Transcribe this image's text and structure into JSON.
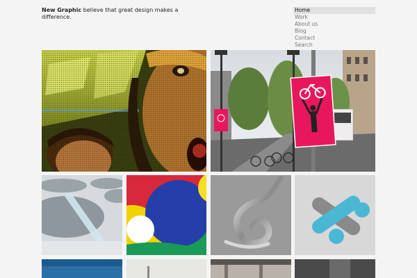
{
  "intro": {
    "brand": "New Graphic",
    "tagline": " believe that great design makes a difference."
  },
  "nav": {
    "items": [
      {
        "label": "Home",
        "active": true
      },
      {
        "label": "Work"
      },
      {
        "label": "About us"
      },
      {
        "label": "Blog"
      },
      {
        "label": "Contact"
      },
      {
        "label": "Search"
      }
    ]
  },
  "colors": {
    "background": "#f4f4f4",
    "accent_pink": "#e8175d",
    "accent_cyan": "#4ab8d4",
    "accent_yellow": "#e8c800",
    "accent_blue": "#2244a8"
  }
}
